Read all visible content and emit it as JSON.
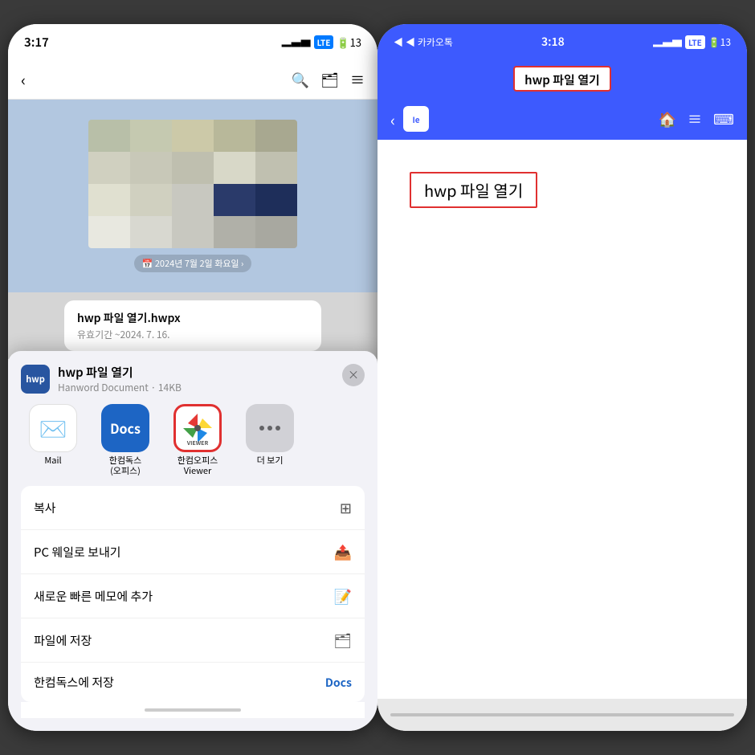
{
  "left_phone": {
    "status": {
      "time": "3:17",
      "signal": "▂▄▆",
      "lte": "LTE",
      "battery_num": "13"
    },
    "chat_header": {
      "back": "‹",
      "icons": [
        "🔍",
        "🗂",
        "≡"
      ]
    },
    "date_badge": "📅 2024년 7월 2일 화요일 ›",
    "file_bubble": {
      "title": "hwp 파일 열기.hwpx",
      "subtitle": "유효기간 ~2024. 7. 16."
    },
    "share_sheet": {
      "title": "hwp 파일 열기",
      "subtitle": "Hanword Document · 14KB",
      "close_label": "×",
      "apps": [
        {
          "id": "mail",
          "label": "Mail"
        },
        {
          "id": "docs",
          "label": "한컴독스\n(오피스)"
        },
        {
          "id": "viewer",
          "label": "한컴오피스\nViewer"
        },
        {
          "id": "more",
          "label": "더 보기"
        }
      ],
      "menu_items": [
        {
          "label": "복사",
          "icon": "copy"
        },
        {
          "label": "PC 웨일로 보내기",
          "icon": "send"
        },
        {
          "label": "새로운 빠른 메모에 추가",
          "icon": "memo"
        },
        {
          "label": "파일에 저장",
          "icon": "folder"
        },
        {
          "label": "한컴독스에 저장",
          "icon": "docs"
        }
      ]
    }
  },
  "right_phone": {
    "status": {
      "back_link": "◀ 카카오톡",
      "time": "3:18",
      "signal": "▂▄▆",
      "lte": "LTE",
      "battery_num": "13"
    },
    "title": "hwp 파일 열기",
    "nav": {
      "back": "‹",
      "logo": "Ie"
    },
    "doc_content": {
      "title": "hwp 파일 열기"
    }
  },
  "colors": {
    "blue_accent": "#3d5afe",
    "red_highlight": "#e03030",
    "docs_blue": "#1d65c4"
  }
}
